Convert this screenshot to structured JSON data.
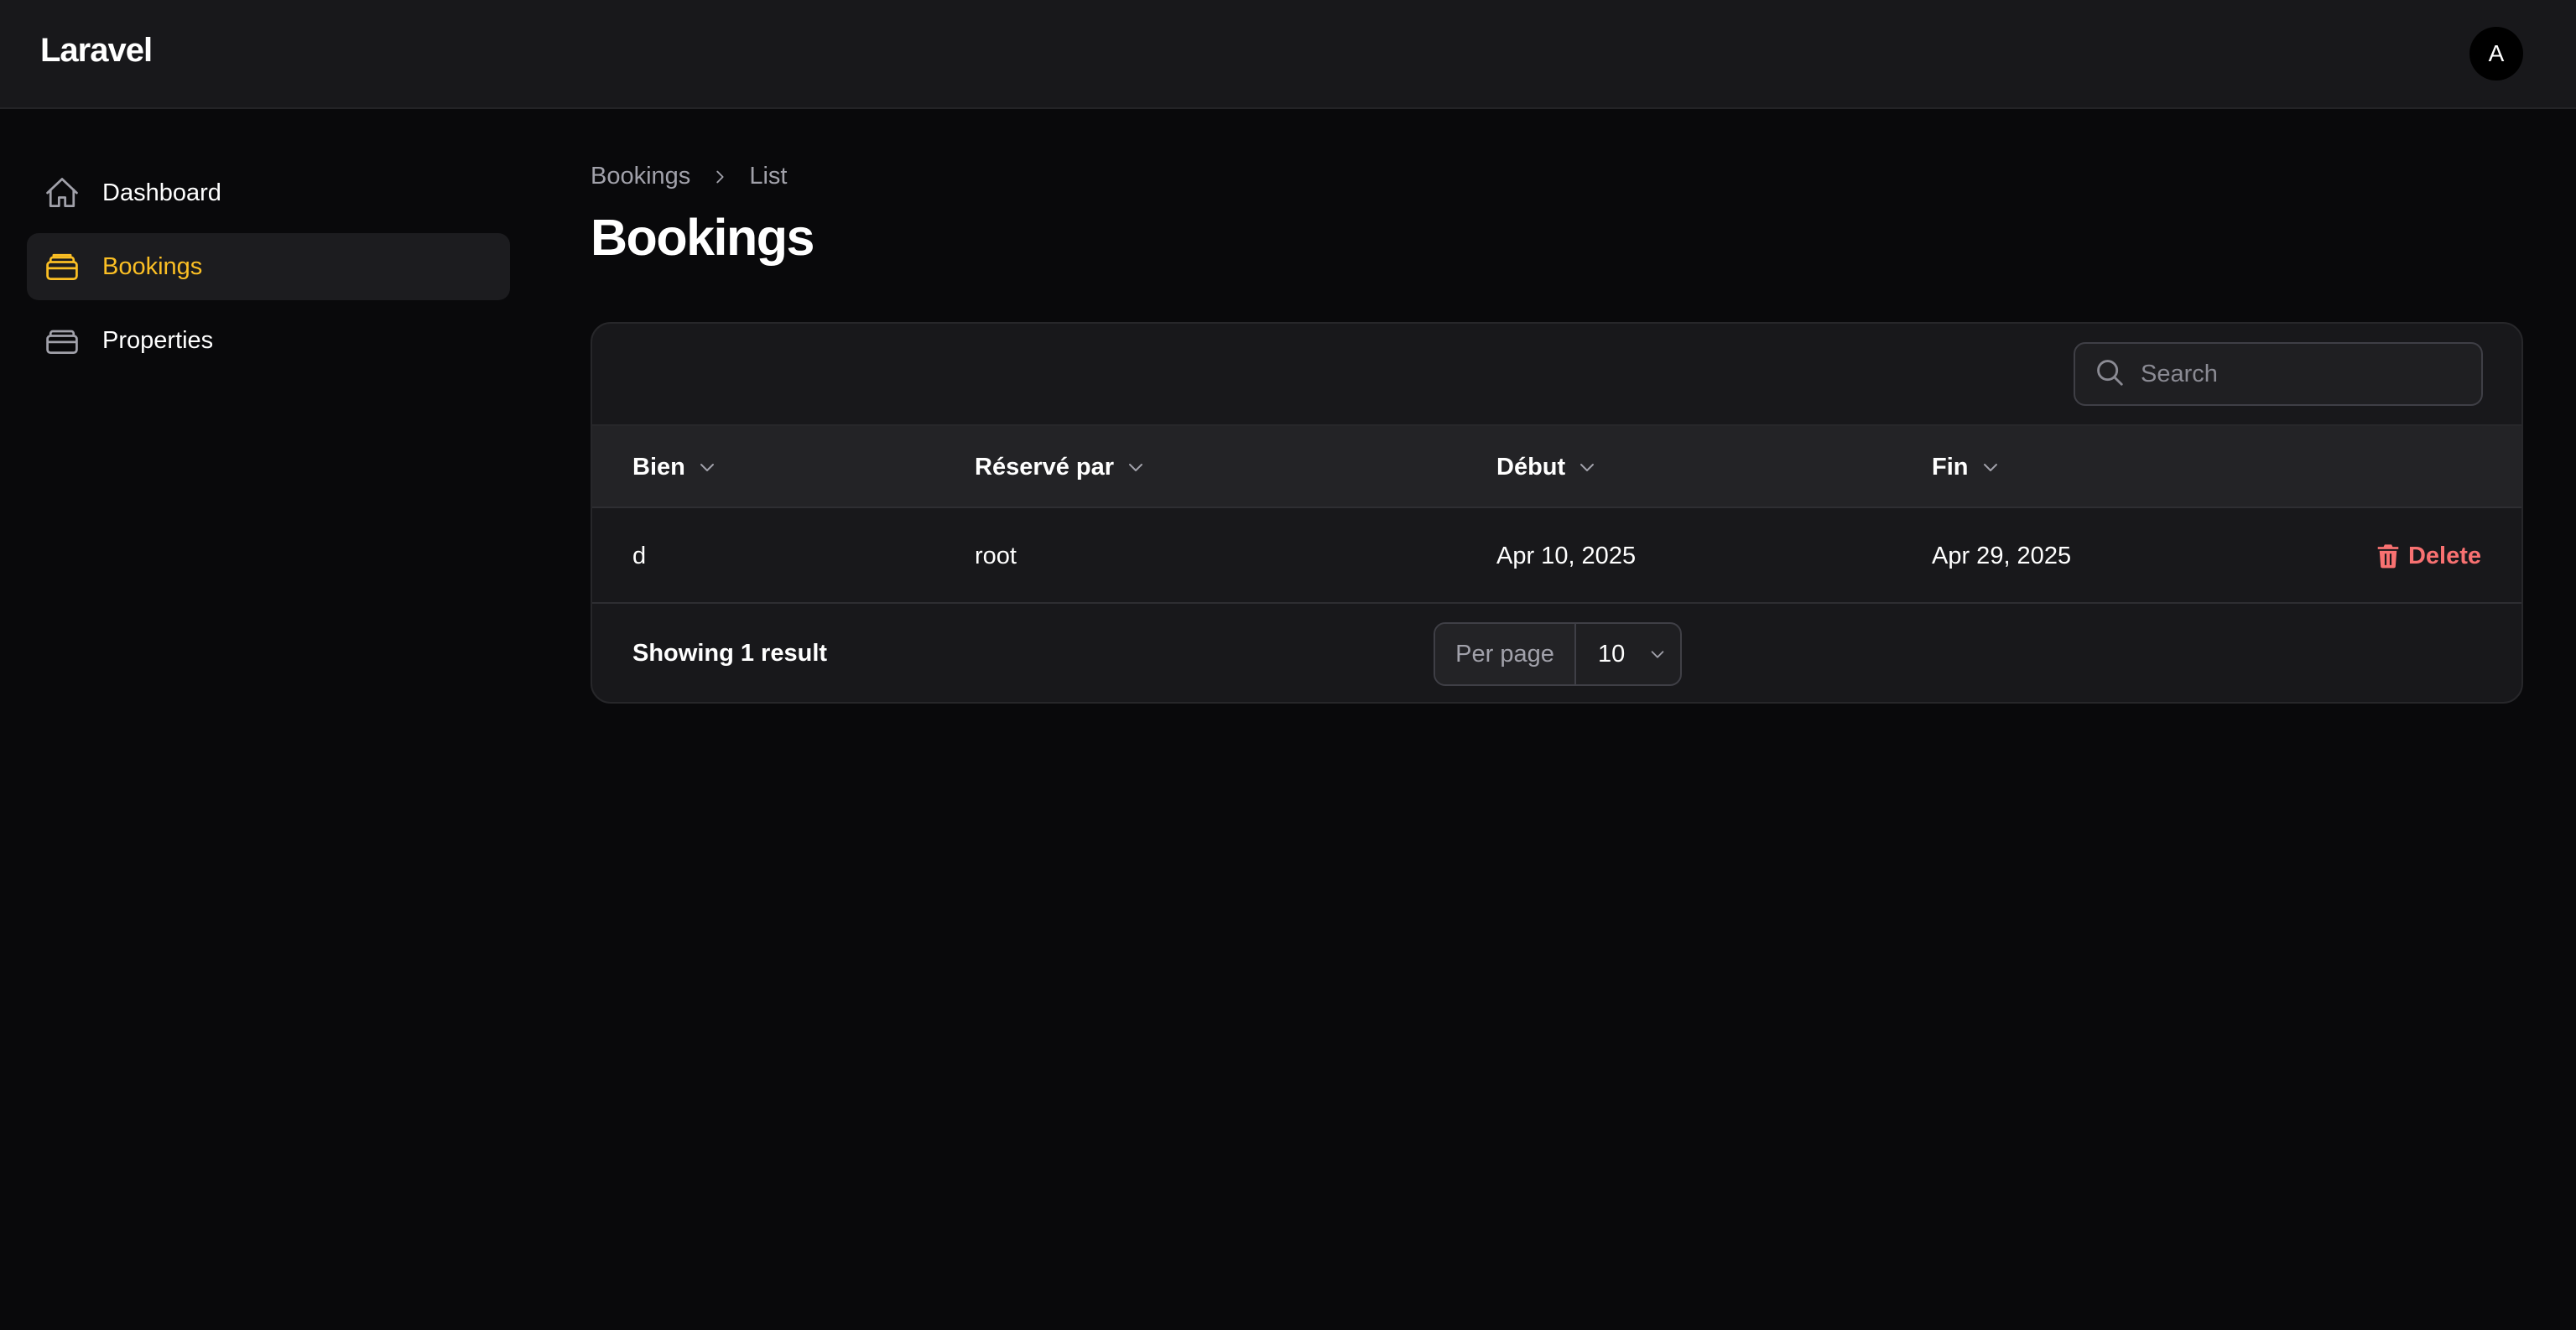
{
  "app": {
    "brand": "Laravel",
    "avatar_initial": "A"
  },
  "sidebar": {
    "items": [
      {
        "label": "Dashboard",
        "icon": "home-icon",
        "active": false
      },
      {
        "label": "Bookings",
        "icon": "inbox-stack-icon",
        "active": true
      },
      {
        "label": "Properties",
        "icon": "inbox-stack-icon",
        "active": false
      }
    ]
  },
  "breadcrumb": {
    "parent": "Bookings",
    "current": "List"
  },
  "page": {
    "title": "Bookings"
  },
  "table": {
    "search_placeholder": "Search",
    "columns": [
      "Bien",
      "Réservé par",
      "Début",
      "Fin"
    ],
    "rows": [
      {
        "bien": "d",
        "reserve_par": "root",
        "debut": "Apr 10, 2025",
        "fin": "Apr 29, 2025",
        "action": "Delete"
      }
    ],
    "summary": "Showing 1 result",
    "per_page_label": "Per page",
    "per_page_value": "10"
  },
  "colors": {
    "background": "#09090b",
    "surface": "#18181b",
    "accent": "#fbbf24",
    "danger": "#f87171"
  }
}
